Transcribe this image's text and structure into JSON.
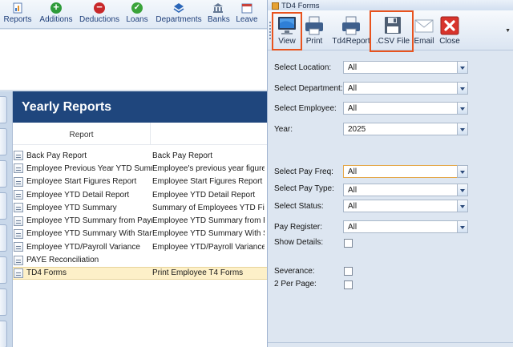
{
  "app_toolbar": {
    "buttons": [
      {
        "label": "Reports",
        "icon": "reports-icon"
      },
      {
        "label": "Additions",
        "icon": "plus-circle-icon"
      },
      {
        "label": "Deductions",
        "icon": "minus-circle-icon"
      },
      {
        "label": "Loans",
        "icon": "check-circle-icon"
      },
      {
        "label": "Departments",
        "icon": "departments-icon"
      },
      {
        "label": "Banks",
        "icon": "bank-icon"
      },
      {
        "label": "Leave",
        "icon": "leave-icon"
      }
    ]
  },
  "reports_pane": {
    "title": "Yearly Reports",
    "column_header": "Report",
    "rows": [
      {
        "name": "Back Pay Report",
        "description": "Back Pay Report"
      },
      {
        "name": "Employee Previous Year YTD Summ",
        "description": "Employee's previous year figure"
      },
      {
        "name": "Employee Start Figures Report",
        "description": "Employee Start Figures Report"
      },
      {
        "name": "Employee YTD Detail Report",
        "description": "Employee YTD Detail Report"
      },
      {
        "name": "Employee YTD Summary",
        "description": "Summary of Employees YTD Fig"
      },
      {
        "name": "Employee YTD Summary from Payr",
        "description": "Employee YTD Summary from Pa"
      },
      {
        "name": "Employee YTD Summary With Start",
        "description": "Employee YTD Summary With St"
      },
      {
        "name": "Employee YTD/Payroll Variance",
        "description": "Employee YTD/Payroll Variance"
      },
      {
        "name": "PAYE Reconciliation",
        "description": ""
      },
      {
        "name": "TD4 Forms",
        "description": "Print Employee T4 Forms",
        "selected": true
      }
    ]
  },
  "dialog": {
    "title": "TD4 Forms",
    "toolbar": {
      "view": "View",
      "print": "Print",
      "td4report": "Td4Report",
      "csv": ".CSV File",
      "email": "Email",
      "close": "Close"
    },
    "highlight_color": "#e8531e",
    "fields": {
      "location": {
        "label": "Select Location:",
        "value": "All"
      },
      "department": {
        "label": "Select Department:",
        "value": "All"
      },
      "employee": {
        "label": "Select Employee:",
        "value": "All"
      },
      "year": {
        "label": "Year:",
        "value": "2025"
      },
      "pay_freq": {
        "label": "Select Pay Freq:",
        "value": "All"
      },
      "pay_type": {
        "label": "Select Pay Type:",
        "value": "All"
      },
      "status": {
        "label": "Select Status:",
        "value": "All"
      },
      "pay_register": {
        "label": "Pay Register:",
        "value": "All"
      },
      "show_details": {
        "label": "Show Details:",
        "checked": false
      },
      "severance": {
        "label": "Severance:",
        "checked": false
      },
      "two_per_page": {
        "label": "2 Per Page:",
        "checked": false
      }
    }
  }
}
